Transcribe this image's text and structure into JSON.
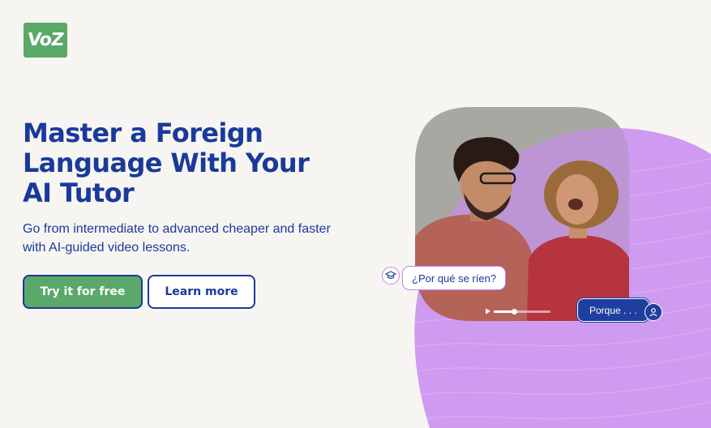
{
  "brand": {
    "logo_text": "VoZ"
  },
  "hero": {
    "title_lines": [
      "Master a Foreign",
      "Language With Your",
      "AI Tutor"
    ],
    "subtitle": "Go from intermediate to advanced cheaper and faster with AI-guided video lessons."
  },
  "buttons": {
    "primary_label": "Try it for free",
    "secondary_label": "Learn more"
  },
  "chat": {
    "question": "¿Por qué se ríen?",
    "answer": "Porque . . ."
  },
  "video": {
    "progress": 0.35
  },
  "colors": {
    "brand_green": "#5aa86a",
    "brand_blue": "#1a3a9a",
    "blob_purple": "#cf9bf0",
    "background": "#f7f5f2"
  },
  "icons": [
    "graduation-cap-icon",
    "user-icon",
    "play-icon"
  ]
}
